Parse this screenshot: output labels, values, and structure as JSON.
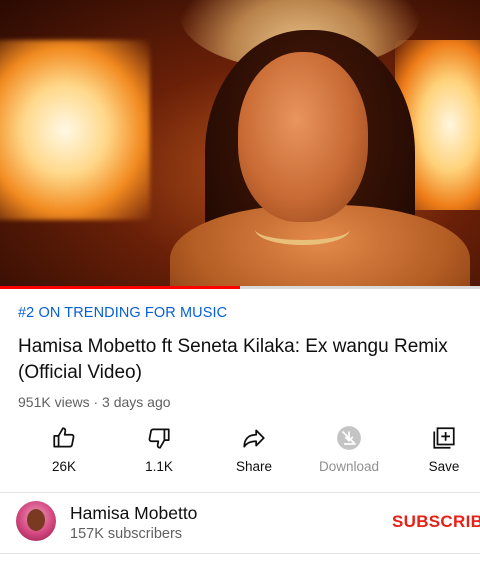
{
  "video": {
    "playback_progress_percent": 50
  },
  "trending_label": "#2 ON TRENDING FOR MUSIC",
  "title": "Hamisa Mobetto ft Seneta Kilaka: Ex wangu Remix (Official Video)",
  "meta": "951K views · 3 days ago",
  "actions": {
    "like": {
      "label": "26K",
      "icon": "thumb-up-icon"
    },
    "dislike": {
      "label": "1.1K",
      "icon": "thumb-down-icon"
    },
    "share": {
      "label": "Share",
      "icon": "share-arrow-icon"
    },
    "download": {
      "label": "Download",
      "icon": "download-disabled-icon"
    },
    "save": {
      "label": "Save",
      "icon": "add-to-playlist-icon"
    }
  },
  "channel": {
    "name": "Hamisa Mobetto",
    "subscribers": "157K subscribers",
    "subscribe_label": "SUBSCRIBE"
  },
  "colors": {
    "trending": "#065fd4",
    "subscribe": "#e62117",
    "progress": "#ff0000"
  }
}
